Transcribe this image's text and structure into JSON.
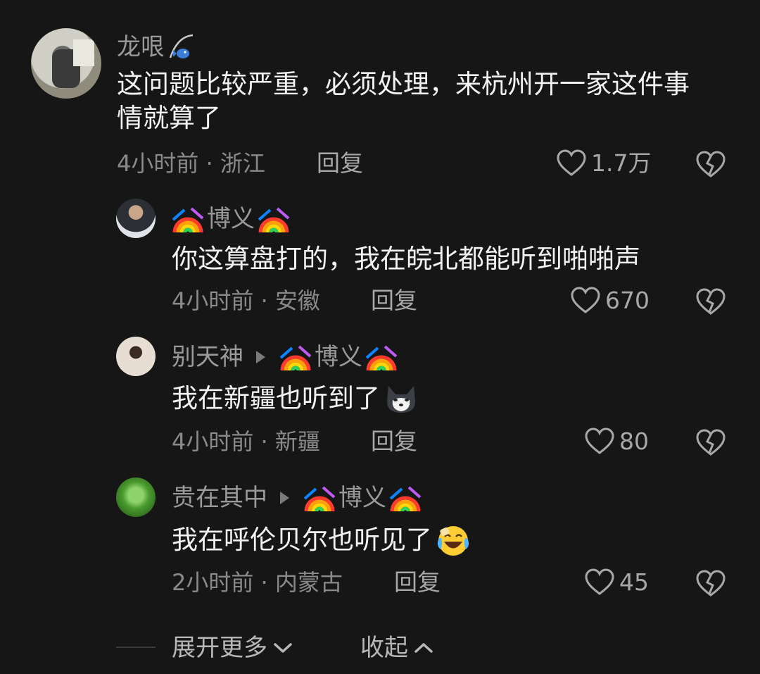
{
  "comments": [
    {
      "author": "龙哏",
      "text": "这问题比较严重，必须处理，来杭州开一家这件事情就算了",
      "meta": "4小时前 · 浙江",
      "reply_label": "回复",
      "likes": "1.7万"
    }
  ],
  "replies": [
    {
      "author": "博义",
      "text": "你这算盘打的，我在皖北都能听到啪啪声",
      "meta": "4小时前 · 安徽",
      "reply_label": "回复",
      "likes": "670"
    },
    {
      "author": "别天神",
      "reply_to": "博义",
      "text": "我在新疆也听到了",
      "meta": "4小时前 · 新疆",
      "reply_label": "回复",
      "likes": "80"
    },
    {
      "author": "贵在其中",
      "reply_to": "博义",
      "text": "我在呼伦贝尔也听见了",
      "meta": "2小时前 · 内蒙古",
      "reply_label": "回复",
      "likes": "45"
    }
  ],
  "footer": {
    "expand_label": "展开更多",
    "collapse_label": "收起"
  },
  "colors": {
    "background": "#161616",
    "text_primary": "#f2f2f2",
    "text_secondary": "#8a8a8a"
  },
  "icons": [
    "fishing-rod-icon",
    "rainbow-icon",
    "heart-icon",
    "broken-heart-icon",
    "play-triangle-icon",
    "dog-emoji-icon",
    "laughing-tears-emoji-icon",
    "chevron-down-icon",
    "chevron-up-icon"
  ]
}
